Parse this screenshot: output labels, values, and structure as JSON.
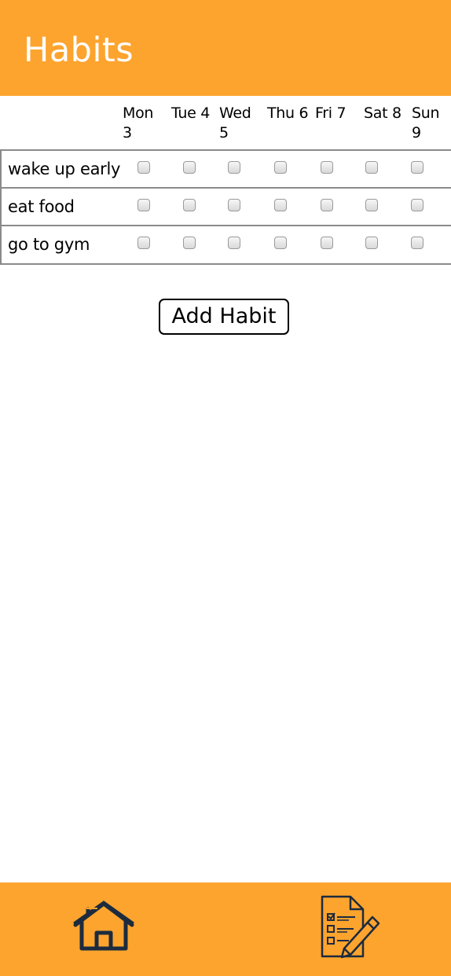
{
  "header": {
    "title": "Habits"
  },
  "days": [
    {
      "label": "Mon 3"
    },
    {
      "label": "Tue 4"
    },
    {
      "label": "Wed 5"
    },
    {
      "label": "Thu 6"
    },
    {
      "label": "Fri 7"
    },
    {
      "label": "Sat 8"
    },
    {
      "label": "Sun 9"
    }
  ],
  "habits": [
    {
      "name": "wake up early"
    },
    {
      "name": "eat food"
    },
    {
      "name": "go to gym"
    }
  ],
  "add_button": {
    "label": "Add Habit"
  },
  "nav": {
    "home_icon": "home-icon",
    "list_icon": "checklist-edit-icon"
  },
  "colors": {
    "accent": "#fda42e",
    "icon": "#1d2b3e",
    "border": "#8a8a8a"
  }
}
